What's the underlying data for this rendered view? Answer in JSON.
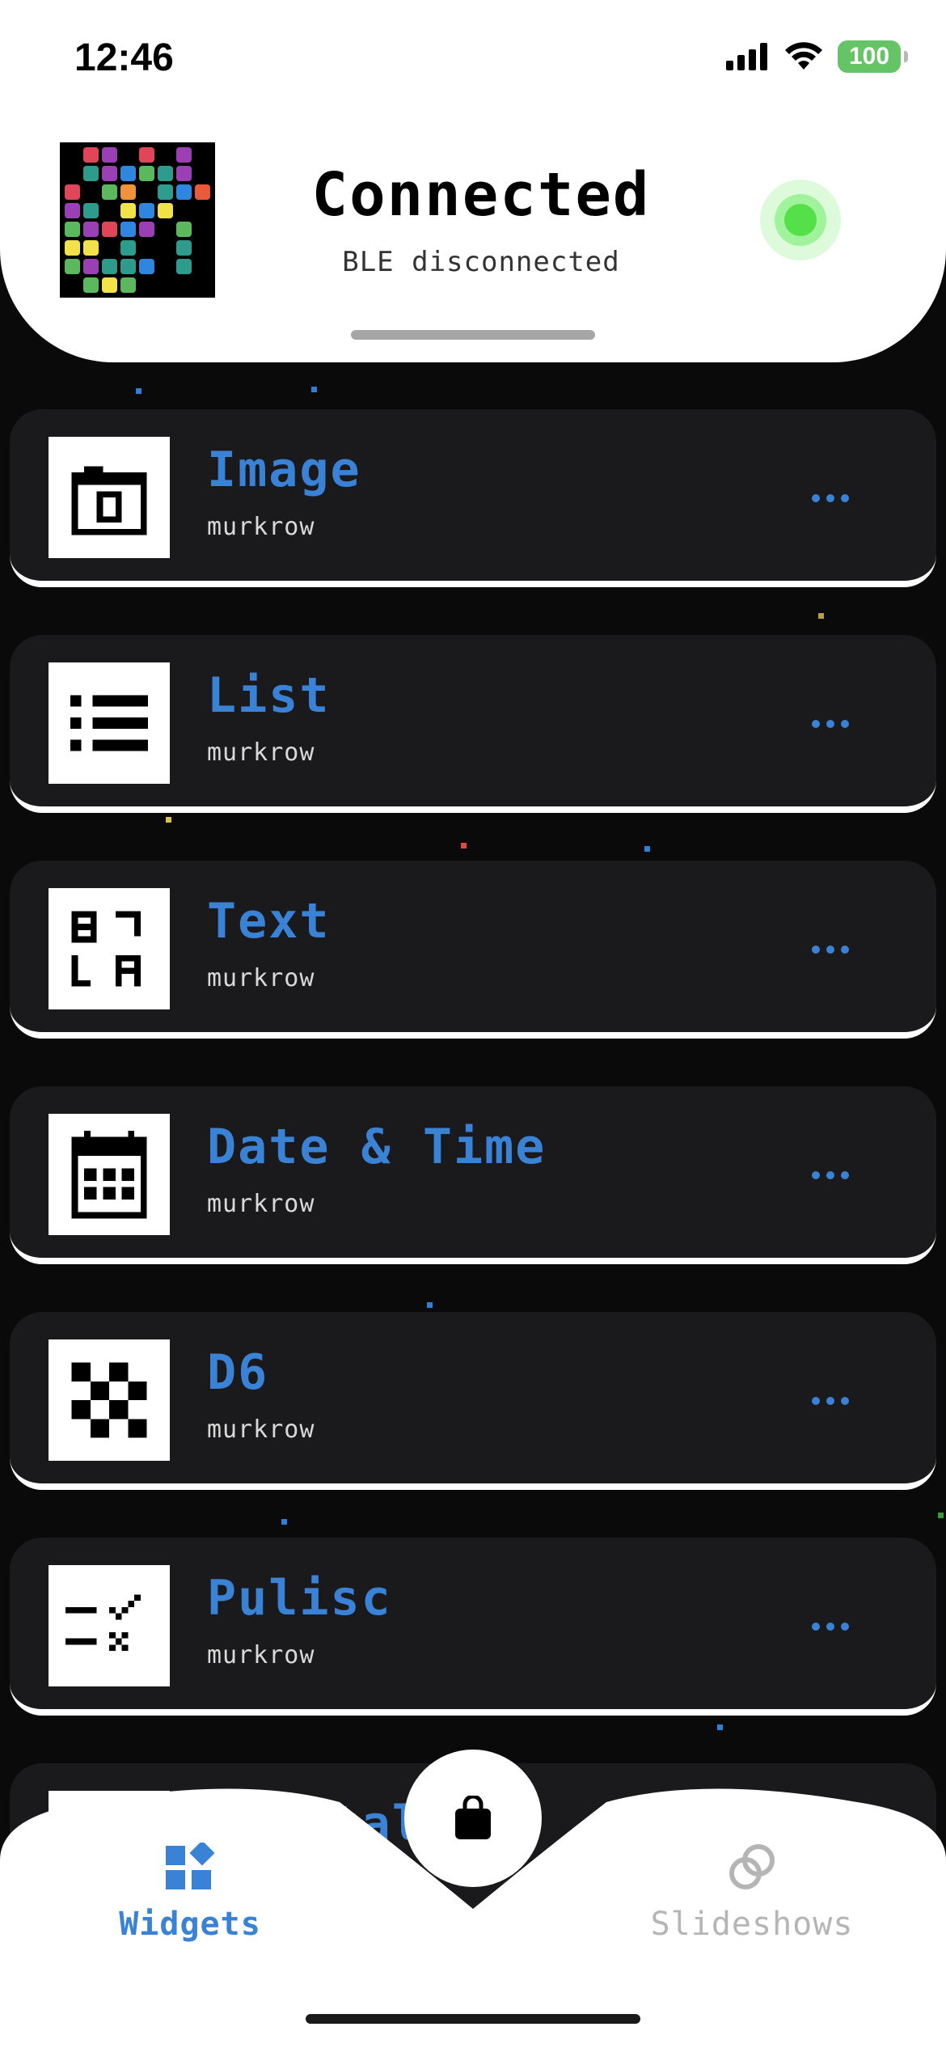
{
  "status_bar": {
    "time": "12:46",
    "battery": "100"
  },
  "header": {
    "title": "Connected",
    "subtitle": "BLE disconnected",
    "colors": {
      "connected_indicator": "#55e04a"
    }
  },
  "widgets": [
    {
      "title": "Image",
      "author": "murkrow",
      "icon": "camera-icon"
    },
    {
      "title": "List",
      "author": "murkrow",
      "icon": "list-icon"
    },
    {
      "title": "Text",
      "author": "murkrow",
      "icon": "text-icon"
    },
    {
      "title": "Date & Time",
      "author": "murkrow",
      "icon": "calendar-icon"
    },
    {
      "title": "D6",
      "author": "murkrow",
      "icon": "checker-icon"
    },
    {
      "title": "Pulisc",
      "author": "murkrow",
      "icon": "checklist-icon"
    },
    {
      "title": "Digital",
      "author": "",
      "icon": "digital-icon"
    }
  ],
  "tabbar": {
    "widgets_label": "Widgets",
    "slideshows_label": "Slideshows",
    "active_tab": "Widgets",
    "colors": {
      "active": "#3a82d6",
      "inactive": "#b5b5b5"
    }
  },
  "colors": {
    "accent": "#3a82d6",
    "card_bg": "#1a1a1c",
    "page_bg": "#0a0a0a"
  }
}
